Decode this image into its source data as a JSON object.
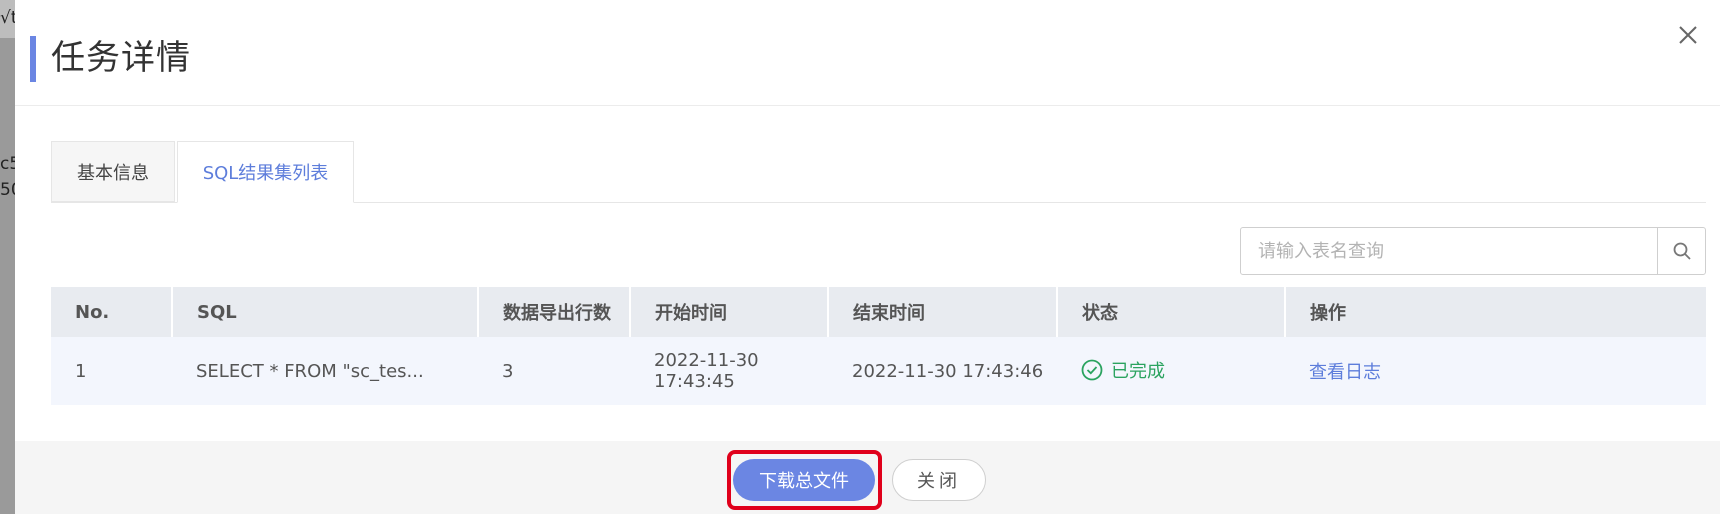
{
  "backdrop": {
    "fragments": [
      "√t",
      "c5",
      "50"
    ]
  },
  "dialog": {
    "title": "任务详情",
    "close_icon": "close-icon"
  },
  "tabs": [
    {
      "label": "基本信息",
      "active": false
    },
    {
      "label": "SQL结果集列表",
      "active": true
    }
  ],
  "search": {
    "placeholder": "请输入表名查询",
    "value": "",
    "icon": "search-icon"
  },
  "table": {
    "headers": [
      "No.",
      "SQL",
      "数据导出行数",
      "开始时间",
      "结束时间",
      "状态",
      "操作"
    ],
    "rows": [
      {
        "no": "1",
        "sql": "SELECT * FROM \"sc_tes...",
        "export_rows": "3",
        "start_time": "2022-11-30 17:43:45",
        "end_time": "2022-11-30 17:43:46",
        "status": "已完成",
        "status_icon": "check-circle-icon",
        "action": "查看日志"
      }
    ]
  },
  "footer": {
    "download_label": "下载总文件",
    "close_label": "关闭"
  },
  "colors": {
    "accent": "#6b86e3",
    "link": "#5d7ddb",
    "success": "#2aa35f",
    "highlight": "#e0001b"
  }
}
